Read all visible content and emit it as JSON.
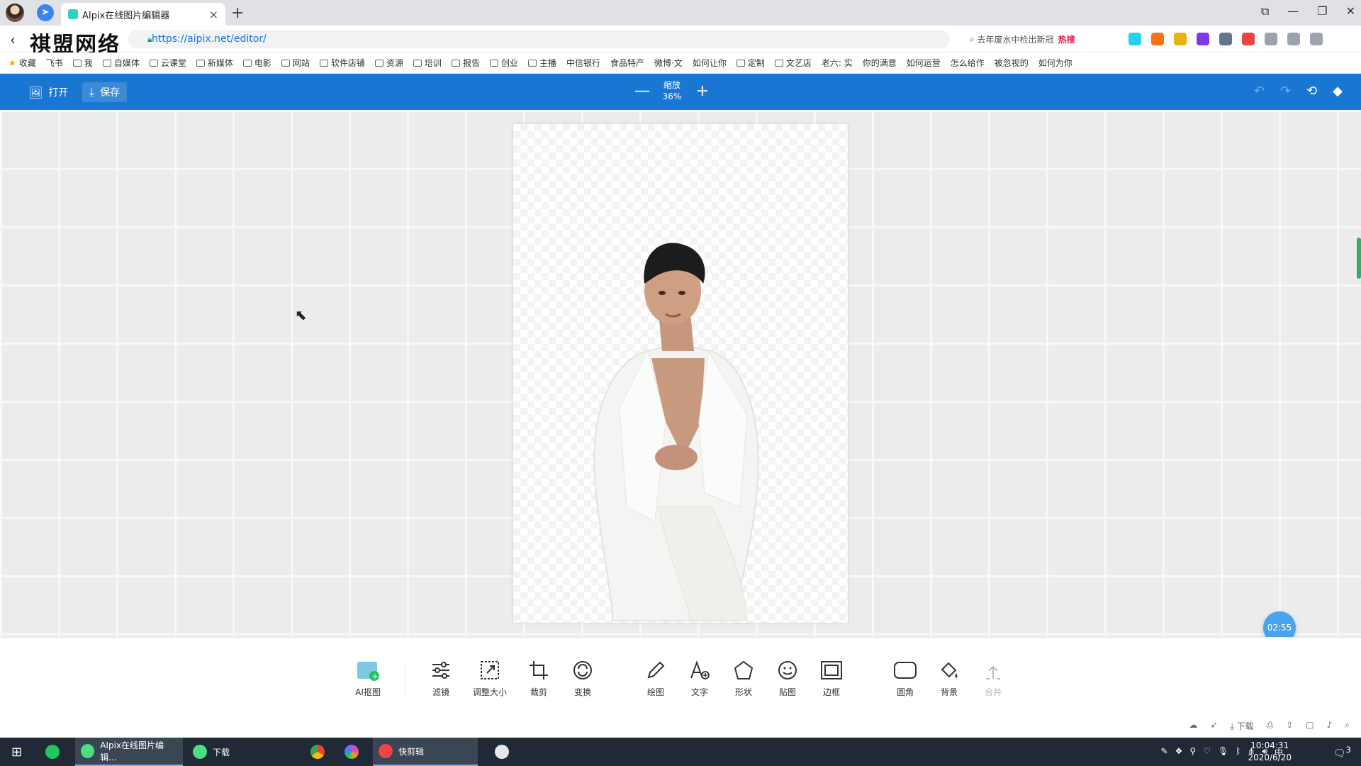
{
  "browser": {
    "tab_title": "AIpix在线图片编辑器",
    "url": "https://aipix.net/editor/",
    "watermark": "祺盟网络",
    "search_hint": "去年废水中检出新冠",
    "search_hot": "热搜",
    "bookmarks": [
      "收藏",
      "飞书",
      "我",
      "自媒体",
      "云课堂",
      "新媒体",
      "电影",
      "网站",
      "软件店铺",
      "资源",
      "培训",
      "报告",
      "创业",
      "主播",
      "中信银行",
      "食品特产",
      "微博·文",
      "如何让你",
      "定制",
      "文艺店",
      "老六: 实",
      "你的满意",
      "如何运营",
      "怎么给作",
      "被忽视的",
      "如何为你"
    ]
  },
  "toolbar": {
    "open_label": "打开",
    "save_label": "保存",
    "zoom_label": "缩放",
    "zoom_value": "36%"
  },
  "canvas": {
    "timer": "02:55"
  },
  "tools": [
    {
      "label": "AI抠图",
      "icon": "ai-matting-icon"
    },
    {
      "label": "滤镜",
      "icon": "filter-sliders-icon"
    },
    {
      "label": "调整大小",
      "icon": "resize-icon"
    },
    {
      "label": "裁剪",
      "icon": "crop-icon"
    },
    {
      "label": "变换",
      "icon": "transform-icon"
    },
    {
      "label": "绘图",
      "icon": "pencil-icon"
    },
    {
      "label": "文字",
      "icon": "text-add-icon"
    },
    {
      "label": "形状",
      "icon": "shape-icon"
    },
    {
      "label": "贴图",
      "icon": "sticker-icon"
    },
    {
      "label": "边框",
      "icon": "frame-icon"
    },
    {
      "label": "圆角",
      "icon": "rounded-corner-icon"
    },
    {
      "label": "背景",
      "icon": "paint-bucket-icon"
    },
    {
      "label": "合并",
      "icon": "merge-icon"
    }
  ],
  "status_bar": {
    "download_label": "下载"
  },
  "taskbar": {
    "apps": [
      "AIpix在线图片编辑...",
      "下载",
      "快剪辑"
    ],
    "time": "10:04:31",
    "date": "2020/6/20",
    "ime": "中",
    "notif_count": "3"
  },
  "colors": {
    "accent": "#1976d2",
    "timer": "#4aa3ef"
  }
}
